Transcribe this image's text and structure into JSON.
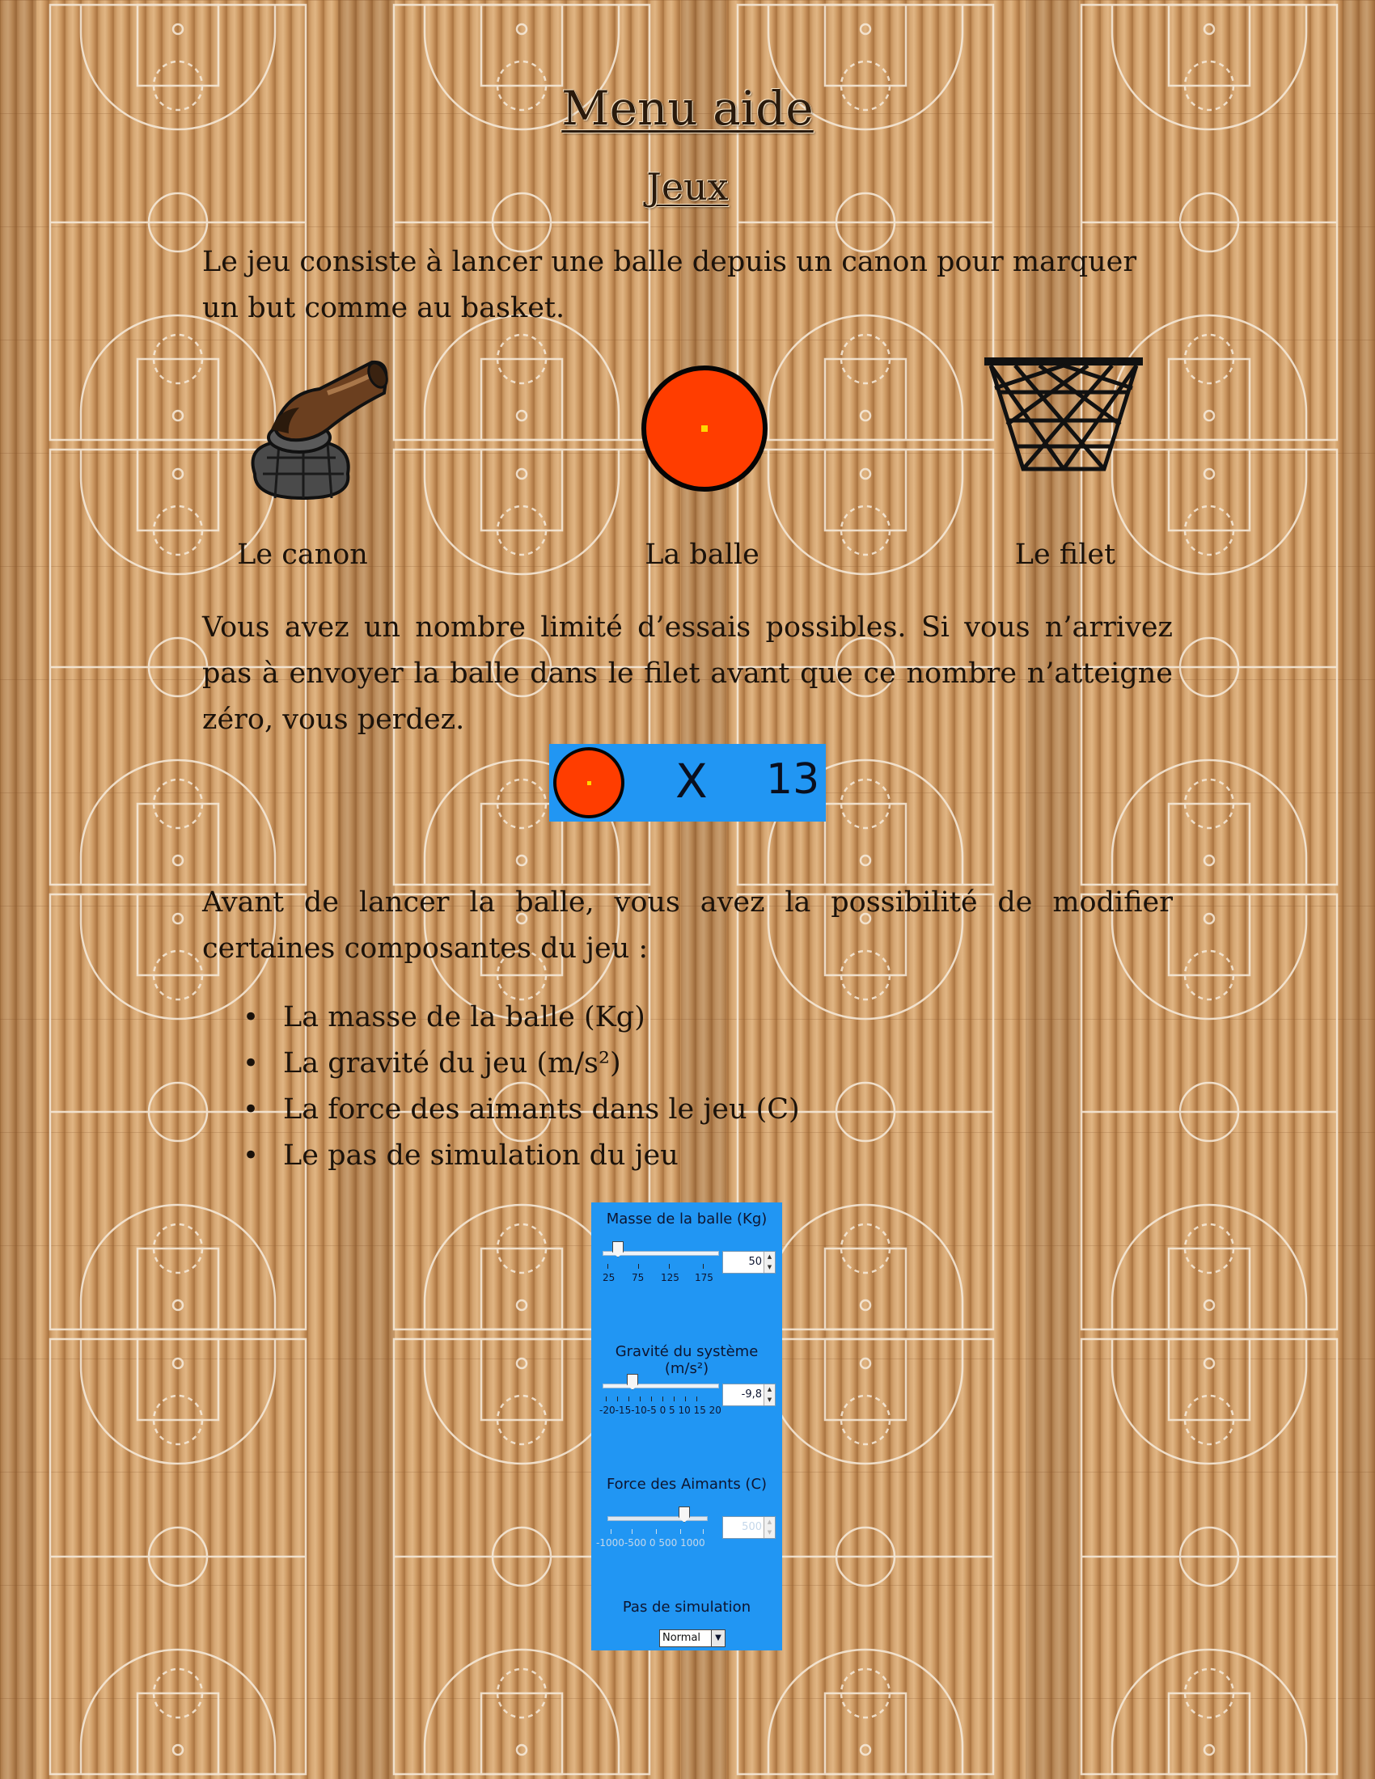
{
  "heading": "Menu aide",
  "subheading": "Jeux",
  "intro": "Le jeu consiste à lancer une balle depuis un canon pour marquer un but comme au basket.",
  "items": [
    {
      "label": "Le canon",
      "icon": "cannon-icon"
    },
    {
      "label": "La balle",
      "icon": "ball-icon"
    },
    {
      "label": "Le filet",
      "icon": "basket-net-icon"
    }
  ],
  "tries_text": "Vous avez un nombre limité d’essais possibles. Si vous n’arrivez pas à envoyer la balle dans le filet avant que ce nombre n’atteigne zéro, vous perdez.",
  "tries_counter": {
    "symbol": "X",
    "value": "13"
  },
  "params_intro": "Avant de lancer la balle, vous avez la possibilité de modifier certaines composantes du jeu :",
  "params": [
    "La masse de la balle (Kg)",
    "La gravité du jeu (m/s²)",
    "La force des aimants dans le jeu (C)",
    "Le pas de simulation du jeu"
  ],
  "panel": {
    "mass": {
      "title": "Masse de la balle (Kg)",
      "value": "50",
      "ticks": [
        "25",
        "75",
        "125",
        "175"
      ]
    },
    "gravity": {
      "title": "Gravité du système (m/s²)",
      "value": "-9,8",
      "ticks": "-20-15-10-5  0   5  10 15 20"
    },
    "magnets": {
      "title": "Force des Aimants (C)",
      "value": "500",
      "ticks": "-1000-500   0    500 1000",
      "enabled": false
    },
    "step": {
      "title": "Pas de simulation",
      "value": "Normal"
    }
  },
  "colors": {
    "panel": "#2196f3",
    "ball": "#ff3d00",
    "wood": "#c89560"
  }
}
